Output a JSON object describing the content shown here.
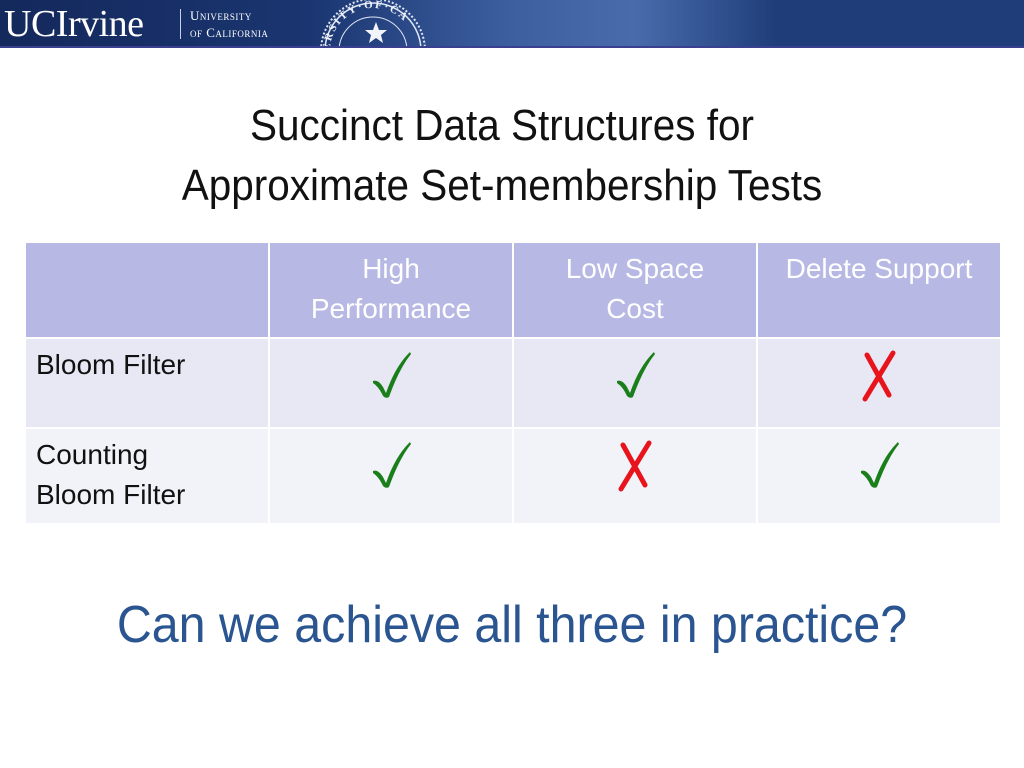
{
  "banner": {
    "logo_text": "UCIrvine",
    "subtitle_line1": "University",
    "subtitle_line2": "of California",
    "seal_text": "ERSITY·OF·CA"
  },
  "slide": {
    "title_line1": "Succinct Data Structures for",
    "title_line2": "Approximate Set-membership Tests",
    "question": "Can we achieve all three in practice?"
  },
  "table": {
    "columns": [
      {
        "lines": [
          ""
        ]
      },
      {
        "lines": [
          "High",
          "Performance"
        ]
      },
      {
        "lines": [
          "Low Space",
          "Cost"
        ]
      },
      {
        "lines": [
          "Delete Support"
        ]
      }
    ],
    "rows": [
      {
        "label_lines": [
          "Bloom Filter"
        ],
        "values": [
          "check",
          "check",
          "cross"
        ]
      },
      {
        "label_lines": [
          "Counting",
          "Bloom Filter"
        ],
        "values": [
          "check",
          "cross",
          "check"
        ]
      }
    ],
    "colors": {
      "check": "#1a7f1a",
      "cross": "#e8141c",
      "header_bg": "#b7b8e4"
    }
  }
}
